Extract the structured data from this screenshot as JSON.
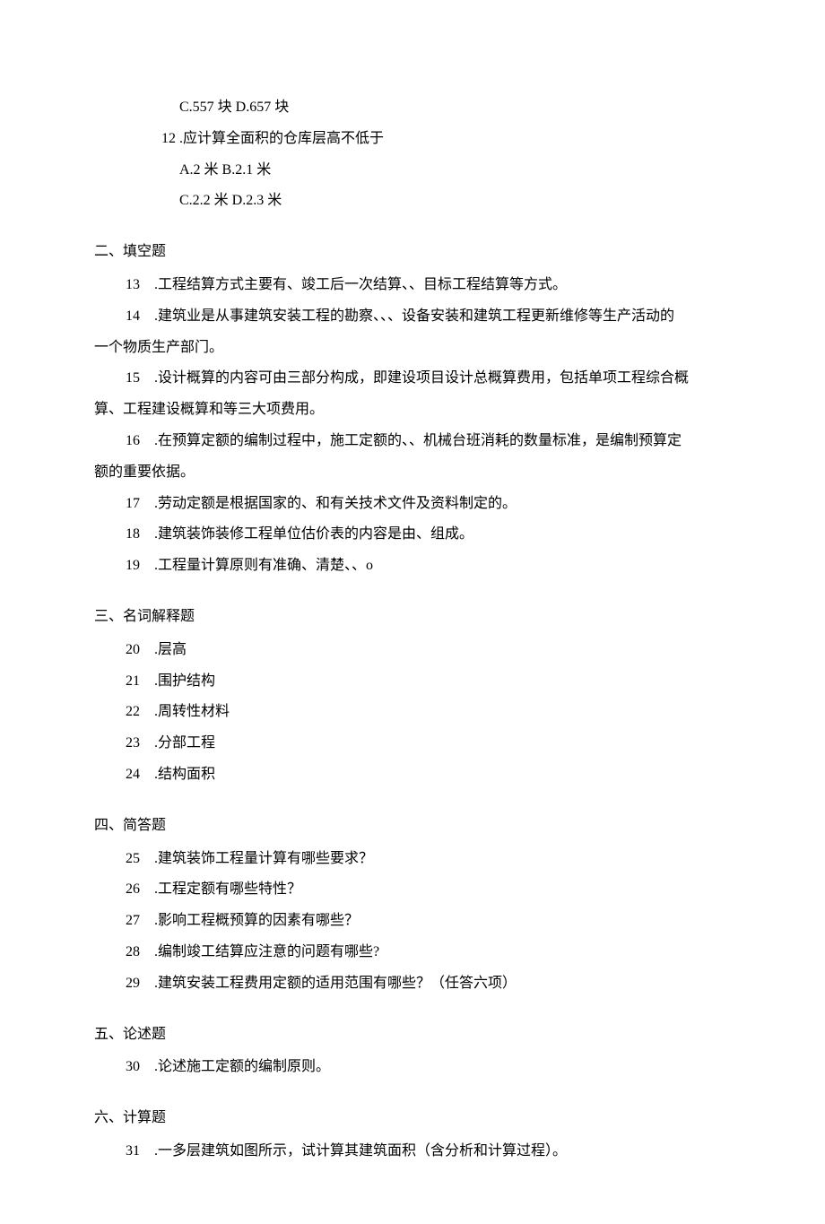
{
  "q11": {
    "optC": "C.557 块 D.657 块"
  },
  "q12": {
    "num": "12",
    "text": ".应计算全面积的仓库层高不低于",
    "optA": "A.2 米 B.2.1 米",
    "optC": "C.2.2 米 D.2.3 米"
  },
  "sec2": {
    "title": "二、填空题",
    "q13": "13　.工程结算方式主要有、竣工后一次结算、、目标工程结算等方式。",
    "q14a": "14　.建筑业是从事建筑安装工程的勘察、、、设备安装和建筑工程更新维修等生产活动的",
    "q14b": "一个物质生产部门。",
    "q15a": "15　.设计概算的内容可由三部分构成，即建设项目设计总概算费用，包括单项工程综合概",
    "q15b": "算、工程建设概算和等三大项费用。",
    "q16a": "16　.在预算定额的编制过程中，施工定额的、、机械台班消耗的数量标准，是编制预算定",
    "q16b": "额的重要依据。",
    "q17": "17　.劳动定额是根据国家的、和有关技术文件及资料制定的。",
    "q18": "18　.建筑装饰装修工程单位估价表的内容是由、组成。",
    "q19": "19　.工程量计算原则有准确、清楚、、o"
  },
  "sec3": {
    "title": "三、名词解释题",
    "q20": "20　.层高",
    "q21": "21　.围护结构",
    "q22": "22　.周转性材料",
    "q23": "23　.分部工程",
    "q24": "24　.结构面积"
  },
  "sec4": {
    "title": "四、简答题",
    "q25": "25　.建筑装饰工程量计算有哪些要求？",
    "q26": "26　.工程定额有哪些特性？",
    "q27": "27　.影响工程概预算的因素有哪些？",
    "q28": "28　.编制竣工结算应注意的问题有哪些?",
    "q29": "29　.建筑安装工程费用定额的适用范围有哪些？（任答六项）"
  },
  "sec5": {
    "title": "五、论述题",
    "q30": "30　.论述施工定额的编制原则。"
  },
  "sec6": {
    "title": "六、计算题",
    "q31": "31　.一多层建筑如图所示，试计算其建筑面积（含分析和计算过程）。"
  }
}
